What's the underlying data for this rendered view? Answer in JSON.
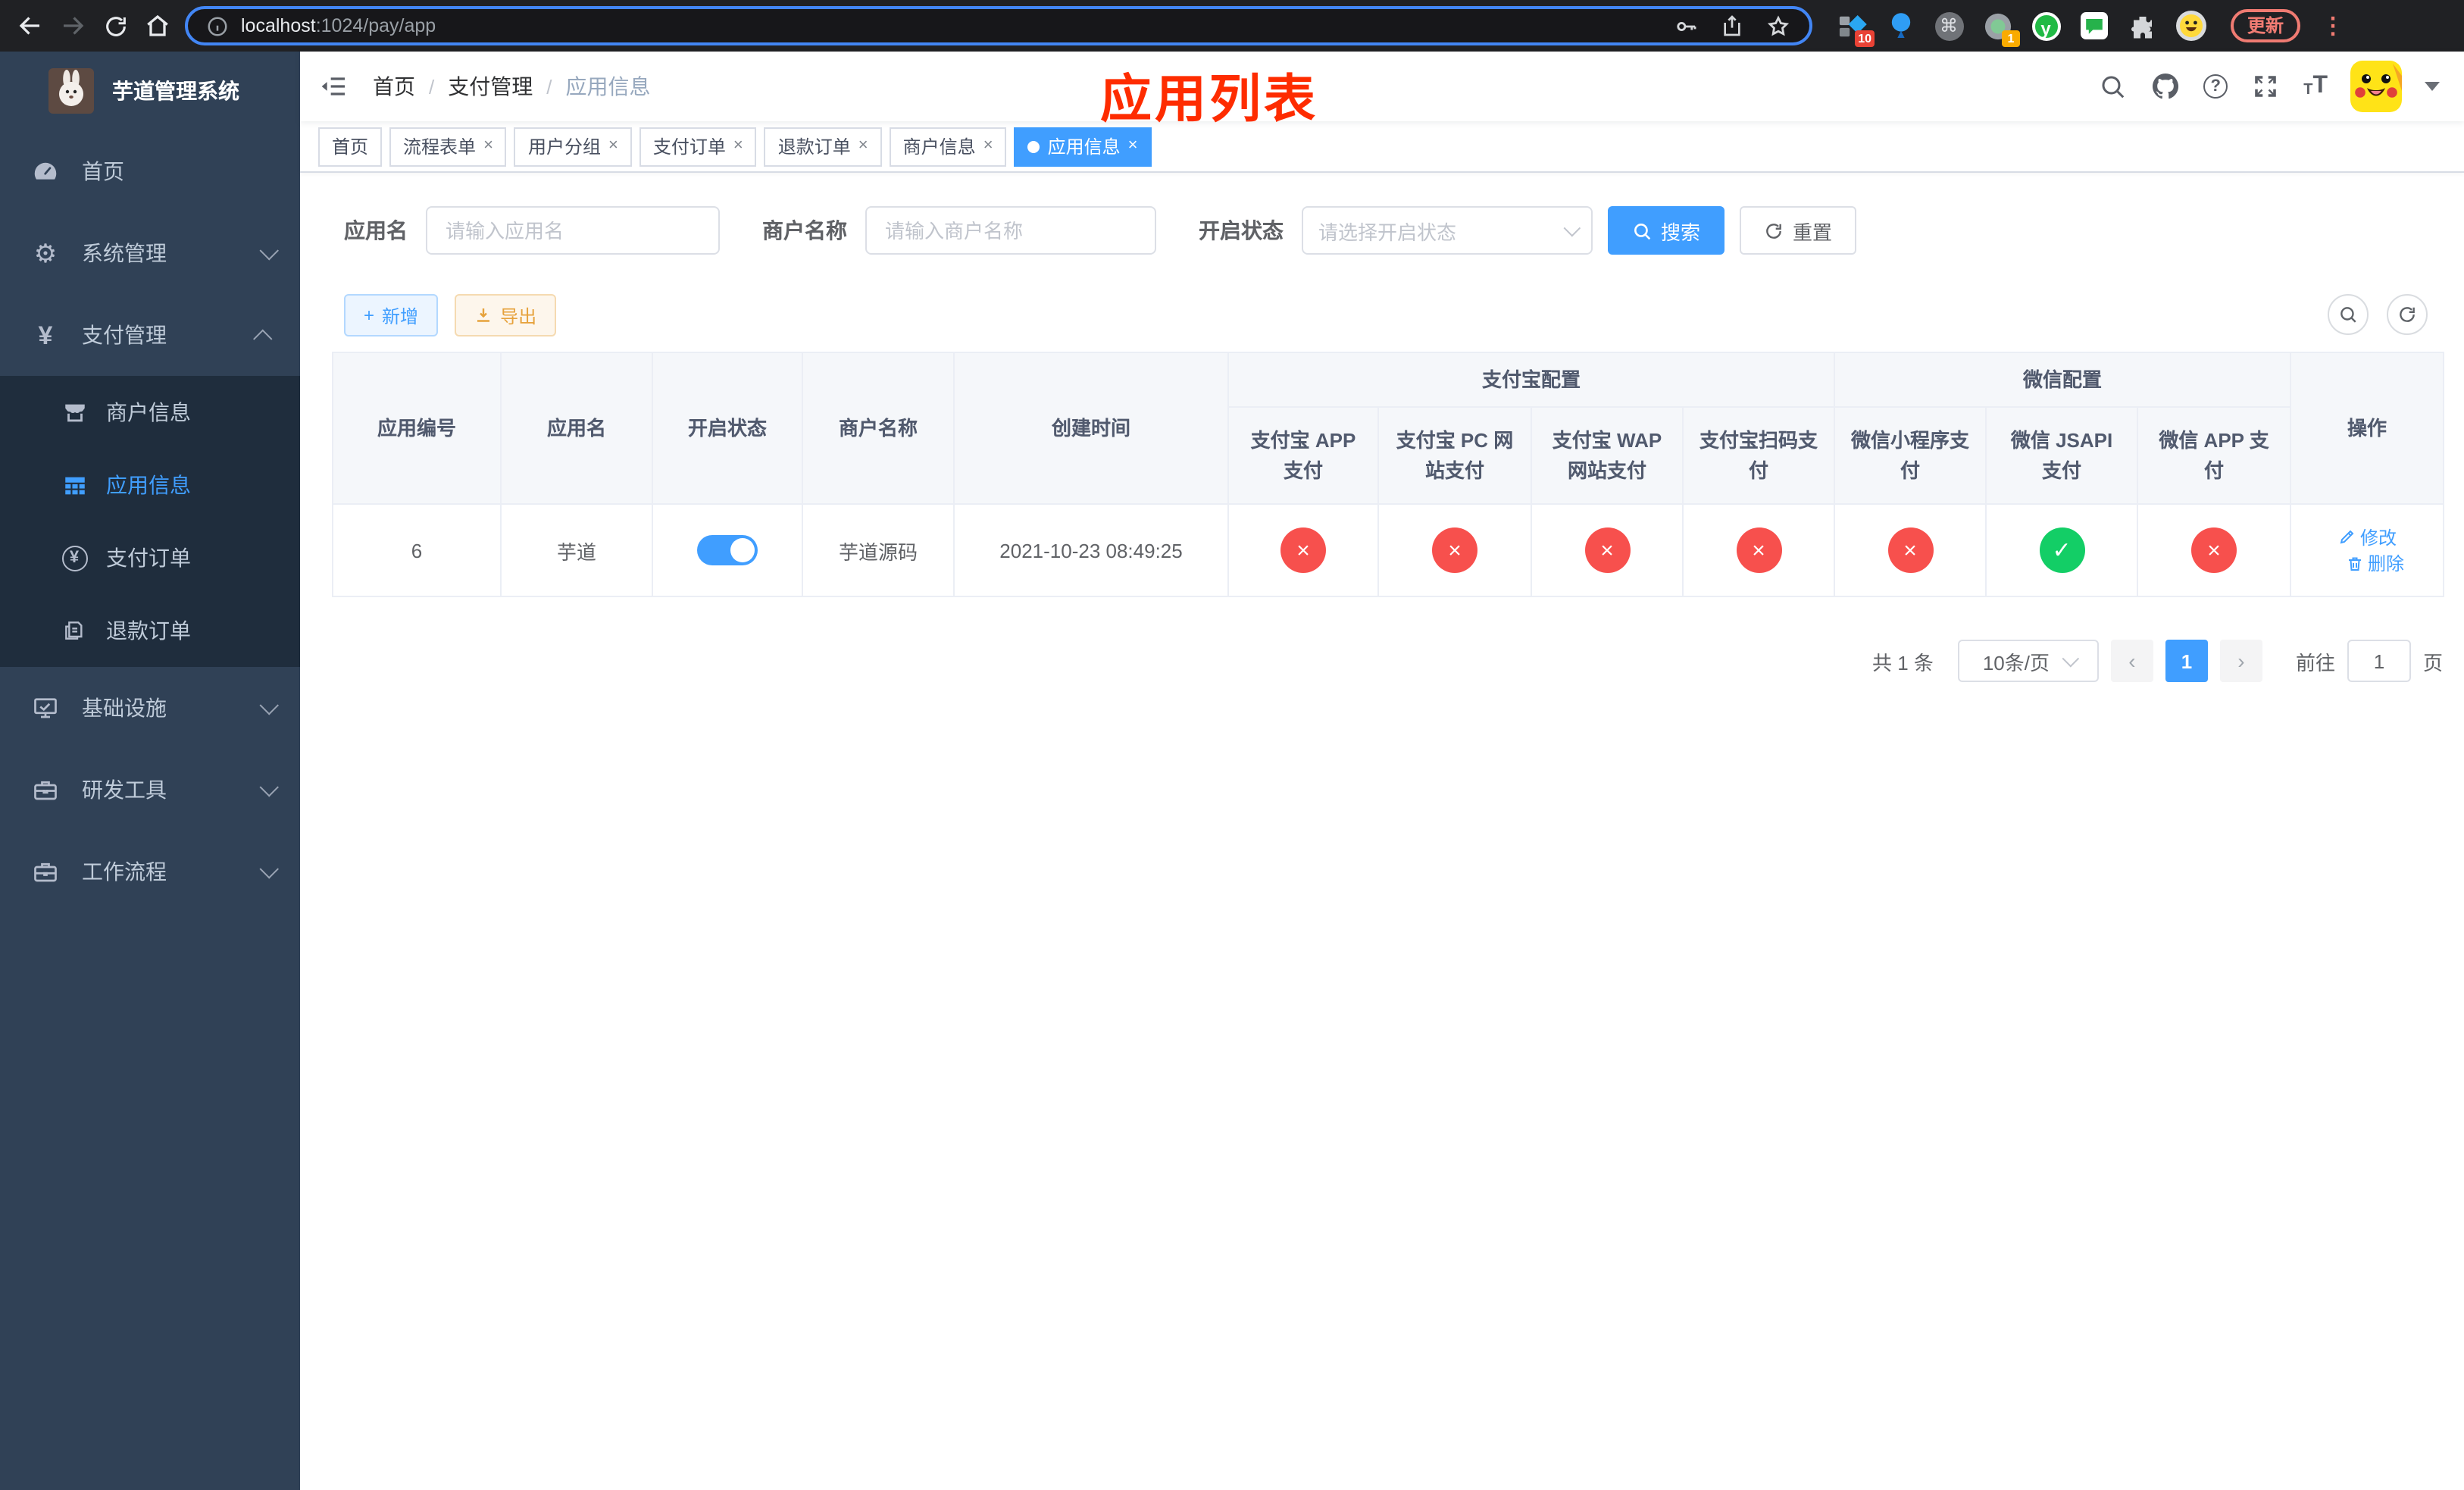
{
  "browser": {
    "url_host": "localhost",
    "url_path": ":1024/pay/app",
    "update_label": "更新",
    "badge_sketch": "10",
    "badge_rec": "1",
    "ext_y_label": "y"
  },
  "icons": {
    "close": "×",
    "check": "✓",
    "yen": "¥",
    "question": "?",
    "command": "⌘",
    "kebab": "⋮",
    "prev": "‹",
    "next": "›",
    "plus": "+",
    "gear": "⚙",
    "font_small": "T",
    "font_large": "T"
  },
  "sidebar": {
    "title": "芋道管理系统",
    "items": [
      {
        "label": "首页"
      },
      {
        "label": "系统管理"
      },
      {
        "label": "支付管理"
      },
      {
        "label": "基础设施"
      },
      {
        "label": "研发工具"
      },
      {
        "label": "工作流程"
      }
    ],
    "submenu": [
      {
        "label": "商户信息"
      },
      {
        "label": "应用信息",
        "active": true
      },
      {
        "label": "支付订单"
      },
      {
        "label": "退款订单"
      }
    ]
  },
  "navbar": {
    "breadcrumb": {
      "home": "首页",
      "sep1": "/",
      "pay": "支付管理",
      "sep2": "/",
      "current": "应用信息"
    },
    "annotation": "应用列表"
  },
  "tabs": [
    {
      "label": "首页"
    },
    {
      "label": "流程表单"
    },
    {
      "label": "用户分组"
    },
    {
      "label": "支付订单"
    },
    {
      "label": "退款订单"
    },
    {
      "label": "商户信息"
    },
    {
      "label": "应用信息"
    }
  ],
  "filters": {
    "app_name_label": "应用名",
    "app_name_placeholder": "请输入应用名",
    "merchant_label": "商户名称",
    "merchant_placeholder": "请输入商户名称",
    "status_label": "开启状态",
    "status_placeholder": "请选择开启状态",
    "search_label": "搜索",
    "reset_label": "重置"
  },
  "toolbar": {
    "add_label": "新增",
    "export_label": "导出"
  },
  "table": {
    "simple_headers": [
      "应用编号",
      "应用名",
      "开启状态",
      "商户名称",
      "创建时间"
    ],
    "groups": [
      {
        "label": "支付宝配置"
      },
      {
        "label": "微信配置"
      }
    ],
    "sub_headers": [
      "支付宝 APP 支付",
      "支付宝 PC 网站支付",
      "支付宝 WAP 网站支付",
      "支付宝扫码支付",
      "微信小程序支付",
      "微信 JSAPI 支付",
      "微信 APP 支付"
    ],
    "action_header": "操作",
    "row": {
      "id": "6",
      "name": "芋道",
      "enabled": true,
      "merchant": "芋道源码",
      "created_at": "2021-10-23 08:49:25",
      "channel_status": [
        "disabled",
        "disabled",
        "disabled",
        "disabled",
        "disabled",
        "enabled",
        "disabled"
      ],
      "edit_label": "修改",
      "delete_label": "删除"
    }
  },
  "pagination": {
    "total_text": "共 1 条",
    "page_size_text": "10条/页",
    "current_page": "1",
    "goto_label": "前往",
    "goto_value": "1",
    "page_unit": "页"
  },
  "colors": {
    "primary": "#409eff",
    "danger": "#f7504d",
    "success": "#13ce66",
    "sidebar": "#304156",
    "annotation": "#fe2c00"
  }
}
